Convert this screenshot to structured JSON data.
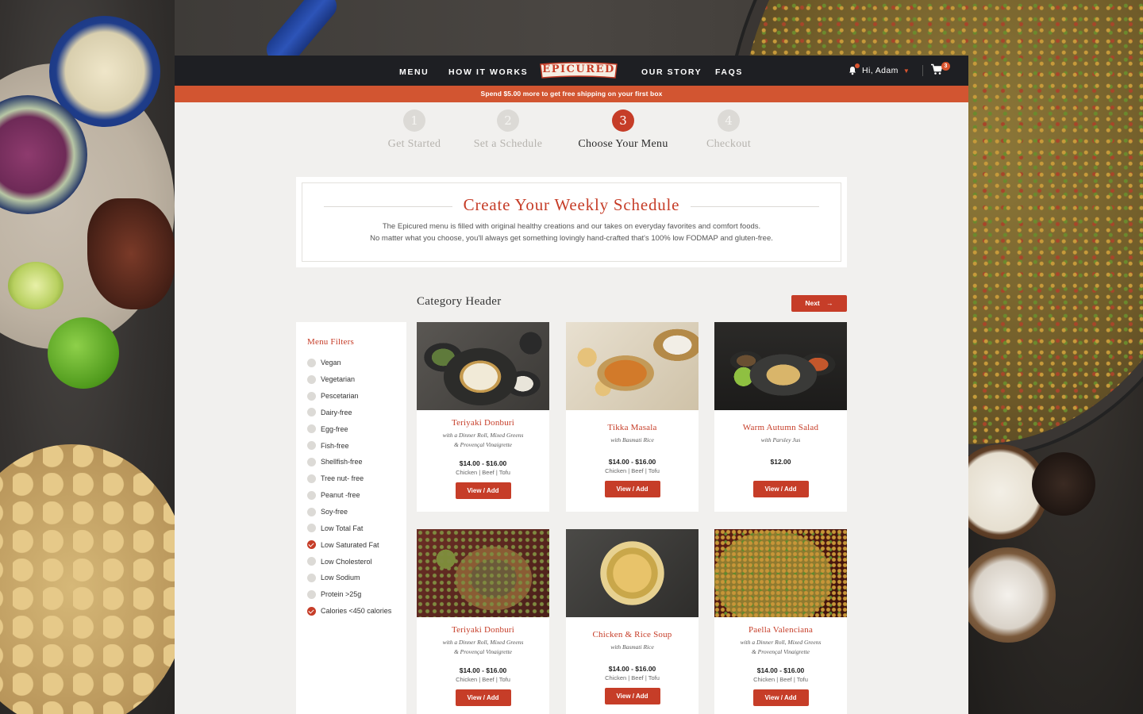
{
  "nav": {
    "links": [
      "Menu",
      "How It Works",
      "Our Story",
      "FAQs"
    ],
    "logo": "EPICURED",
    "greeting": "Hi, Adam",
    "cart_count": "3"
  },
  "promo": "Spend $5.00 more to get free shipping on your first box",
  "steps": [
    {
      "num": "1",
      "label": "Get Started"
    },
    {
      "num": "2",
      "label": "Set a Schedule"
    },
    {
      "num": "3",
      "label": "Choose Your Menu"
    },
    {
      "num": "4",
      "label": "Checkout"
    }
  ],
  "hero": {
    "title": "Create Your Weekly Schedule",
    "line1": "The Epicured menu is filled with original healthy creations and our takes on everyday favorites and comfort foods.",
    "line2": "No matter what you choose, you'll always get something lovingly hand-crafted that's 100% low FODMAP and gluten-free."
  },
  "category_header": "Category Header",
  "next_label": "Next",
  "filters": {
    "title": "Menu Filters",
    "items": [
      {
        "label": "Vegan",
        "checked": false
      },
      {
        "label": "Vegetarian",
        "checked": false
      },
      {
        "label": "Pescetarian",
        "checked": false
      },
      {
        "label": "Dairy-free",
        "checked": false
      },
      {
        "label": "Egg-free",
        "checked": false
      },
      {
        "label": "Fish-free",
        "checked": false
      },
      {
        "label": "Shellfish-free",
        "checked": false
      },
      {
        "label": "Tree nut- free",
        "checked": false
      },
      {
        "label": "Peanut -free",
        "checked": false
      },
      {
        "label": "Soy-free",
        "checked": false
      },
      {
        "label": "Low Total Fat",
        "checked": false
      },
      {
        "label": "Low Saturated Fat",
        "checked": true
      },
      {
        "label": "Low Cholesterol",
        "checked": false
      },
      {
        "label": "Low Sodium",
        "checked": false
      },
      {
        "label": "Protein >25g",
        "checked": false
      },
      {
        "label": "Calories <450 calories",
        "checked": true
      }
    ]
  },
  "cards": [
    {
      "title": "Teriyaki Donburi",
      "sub1": "with a Dinner Roll, Mixed Greens",
      "sub2": "& Provençal Vinaigrette",
      "price": "$14.00 - $16.00",
      "proteins": "Chicken | Beef | Tofu",
      "button": "View / Add"
    },
    {
      "title": "Tikka Masala",
      "sub1": "with Basmati Rice",
      "sub2": "",
      "price": "$14.00 - $16.00",
      "proteins": "Chicken | Beef | Tofu",
      "button": "View / Add"
    },
    {
      "title": "Warm Autumn Salad",
      "sub1": "with Parsley Jus",
      "sub2": "",
      "price": "$12.00",
      "proteins": "",
      "button": "View / Add"
    },
    {
      "title": "Teriyaki Donburi",
      "sub1": "with a Dinner Roll, Mixed Greens",
      "sub2": "& Provençal Vinaigrette",
      "price": "$14.00 - $16.00",
      "proteins": "Chicken | Beef | Tofu",
      "button": "View / Add"
    },
    {
      "title": "Chicken & Rice Soup",
      "sub1": "with Basmati Rice",
      "sub2": "",
      "price": "$14.00 - $16.00",
      "proteins": "Chicken | Beef | Tofu",
      "button": "View / Add"
    },
    {
      "title": "Paella Valenciana",
      "sub1": "with a Dinner Roll, Mixed Greens",
      "sub2": "& Provençal Vinaigrette",
      "price": "$14.00 - $16.00",
      "proteins": "Chicken | Beef | Tofu",
      "button": "View / Add"
    }
  ],
  "colors": {
    "accent": "#c63d28",
    "promo": "#d25531",
    "nav": "#1e1f23"
  }
}
